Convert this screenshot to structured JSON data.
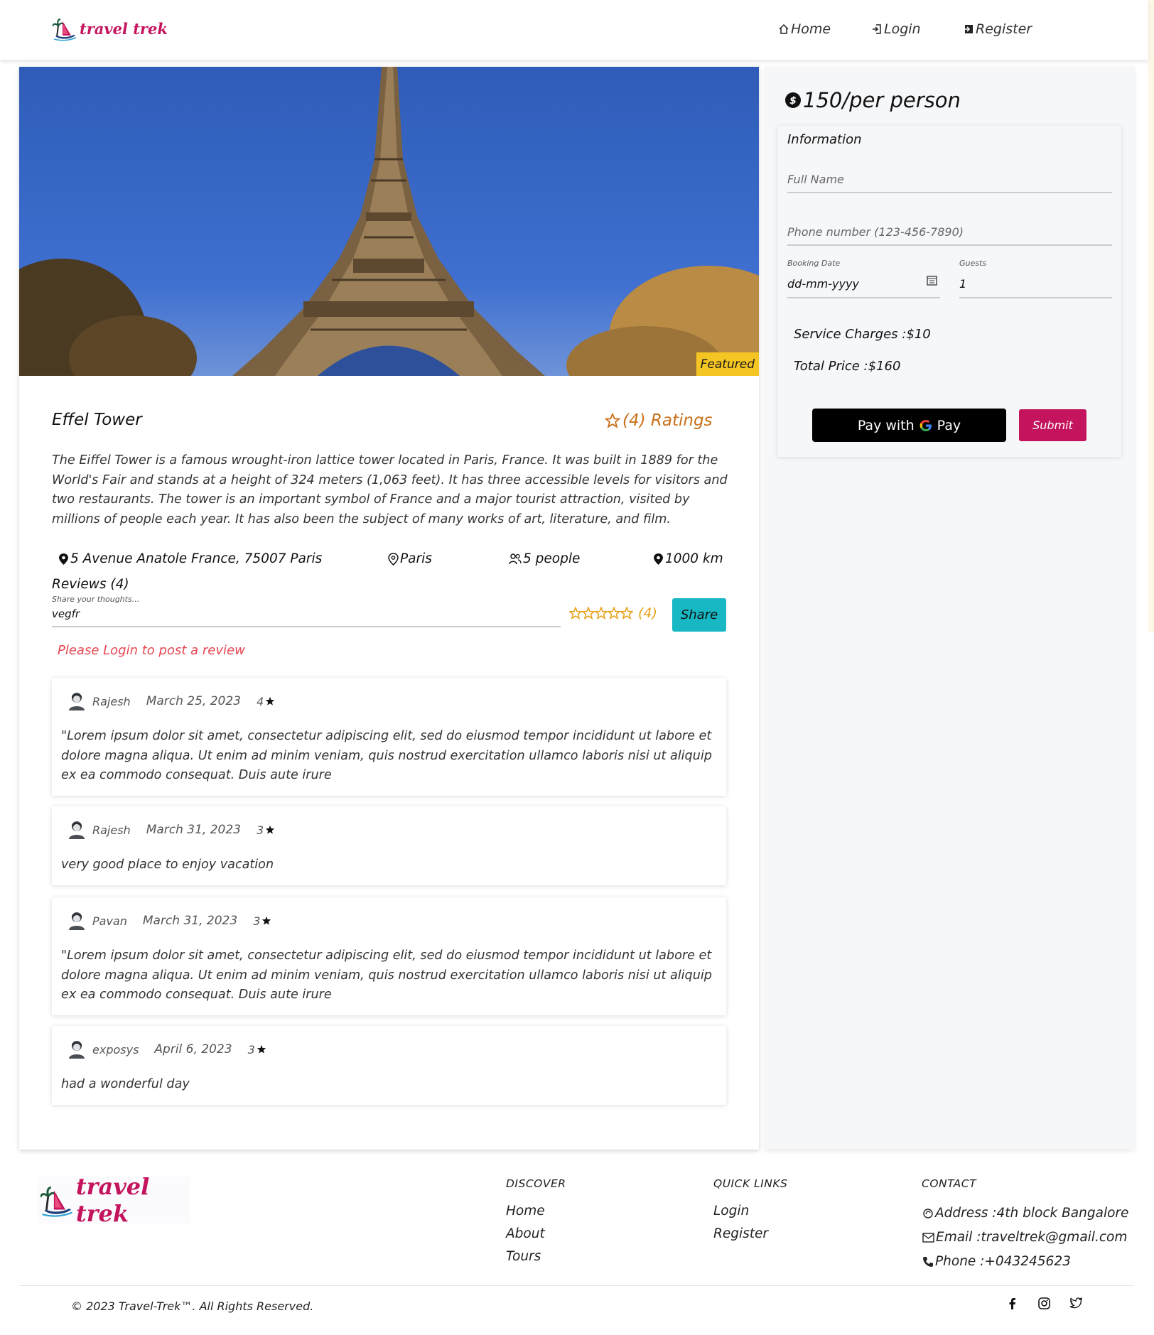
{
  "header": {
    "logo_text": "travel trek",
    "nav": [
      {
        "label": "Home",
        "icon": "home-icon"
      },
      {
        "label": "Login",
        "icon": "login-icon"
      },
      {
        "label": "Register",
        "icon": "register-icon"
      }
    ]
  },
  "hero": {
    "image": "eiffel-tower-photo",
    "badge": "Featured"
  },
  "tour": {
    "title": "Effel Tower",
    "ratings": "(4) Ratings",
    "description": "The Eiffel Tower is a famous wrought-iron lattice tower located in Paris, France. It was built in 1889 for the World's Fair and stands at a height of 324 meters (1,063 feet). It has three accessible levels for visitors and two restaurants. The tower is an important symbol of France and a major tourist attraction, visited by millions of people each year. It has also been the subject of many works of art, literature, and film.",
    "address": "5 Avenue Anatole France, 75007 Paris",
    "city": "Paris",
    "group_size": "5 people",
    "distance": "1000 km"
  },
  "reviews": {
    "title": "Reviews (4)",
    "input_label": "Share your thoughts...",
    "input_value": "vegfr",
    "star_count": "(4)",
    "share_label": "Share",
    "login_warning": "Please Login to post a review",
    "items": [
      {
        "user": "Rajesh",
        "date": "March 25, 2023",
        "rating": "4",
        "text": "\"Lorem ipsum dolor sit amet, consectetur adipiscing elit, sed do eiusmod tempor incididunt ut labore et dolore magna aliqua. Ut enim ad minim veniam, quis nostrud exercitation ullamco laboris nisi ut aliquip ex ea commodo consequat. Duis aute irure"
      },
      {
        "user": "Rajesh",
        "date": "March 31, 2023",
        "rating": "3",
        "text": "very good place to enjoy vacation"
      },
      {
        "user": "Pavan",
        "date": "March 31, 2023",
        "rating": "3",
        "text": "\"Lorem ipsum dolor sit amet, consectetur adipiscing elit, sed do eiusmod tempor incididunt ut labore et dolore magna aliqua. Ut enim ad minim veniam, quis nostrud exercitation ullamco laboris nisi ut aliquip ex ea commodo consequat. Duis aute irure"
      },
      {
        "user": "exposys",
        "date": "April 6, 2023",
        "rating": "3",
        "text": "had a wonderful day"
      }
    ]
  },
  "booking": {
    "price": "150/per person",
    "info_title": "Information",
    "full_name_placeholder": "Full Name",
    "phone_placeholder": "Phone number (123-456-7890)",
    "date_label": "Booking Date",
    "date_value": "dd-mm-yyyy",
    "guests_label": "Guests",
    "guests_value": "1",
    "service_charges": "Service Charges :$10",
    "total_price": "Total Price :$160",
    "gpay_label": "Pay with",
    "gpay_brand": "Pay",
    "submit_label": "Submit"
  },
  "footer": {
    "logo_text": "travel trek",
    "discover_title": "DISCOVER",
    "discover_links": [
      "Home",
      "About",
      "Tours"
    ],
    "quick_title": "QUICK LINKS",
    "quick_links": [
      "Login",
      "Register"
    ],
    "contact_title": "CONTACT",
    "address": "Address :4th block Bangalore",
    "email": "Email :traveltrek@gmail.com",
    "phone": "Phone :+043245623",
    "copyright": "© 2023 Travel-Trek™. All Rights Reserved.",
    "social": [
      "facebook-icon",
      "instagram-icon",
      "twitter-icon"
    ]
  },
  "colors": {
    "brand": "#c4145d",
    "share": "#17b8c4",
    "featured": "#f5c623",
    "rating": "#c96f1b",
    "warning": "#e64652"
  }
}
